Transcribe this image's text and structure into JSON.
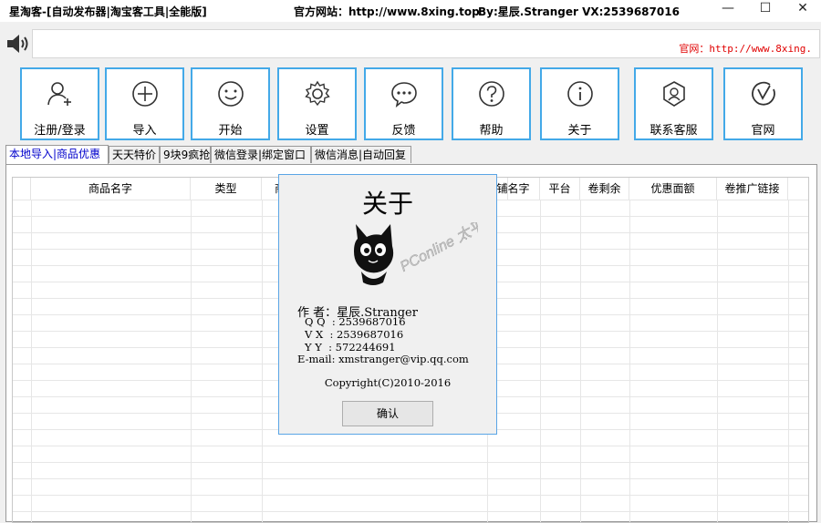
{
  "window": {
    "title": "星淘客-[自动发布器|淘宝客工具|全能版]",
    "site_label": "官方网站：http://www.8xing.top",
    "author_label": "By:星辰.Stranger   VX:2539687016"
  },
  "notice": {
    "text": "官网：http://www.8xing."
  },
  "toolbar": [
    {
      "label": "注册/登录",
      "icon": "user-add-icon"
    },
    {
      "label": "导入",
      "icon": "plus-circle-icon"
    },
    {
      "label": "开始",
      "icon": "smiley-icon"
    },
    {
      "label": "设置",
      "icon": "gear-icon"
    },
    {
      "label": "反馈",
      "icon": "chat-icon"
    },
    {
      "label": "帮助",
      "icon": "question-icon"
    },
    {
      "label": "关于",
      "icon": "info-icon"
    },
    {
      "label": "联系客服",
      "icon": "support-icon"
    },
    {
      "label": "官网",
      "icon": "website-icon"
    }
  ],
  "tabs": [
    "本地导入|商品优惠",
    "天天特价",
    "9块9疯抢",
    "微信登录|绑定窗口",
    "微信消息|自动回复"
  ],
  "table": {
    "headers": [
      "商品名字",
      "类型",
      "商",
      "铺名字",
      "平台",
      "卷剩余",
      "优惠面额",
      "卷推广链接"
    ]
  },
  "about": {
    "title": "关于",
    "author": "作 者：星辰.Stranger",
    "qq": "Q Q  : 2539687016",
    "vx": "V X  : 2539687016",
    "yy": "Y Y  : 572244691",
    "email": "E-mail: xmstranger@vip.qq.com",
    "copyright": "Copyright(C)2010-2016",
    "ok": "确认",
    "watermark": "PConline 太平洋下载"
  }
}
